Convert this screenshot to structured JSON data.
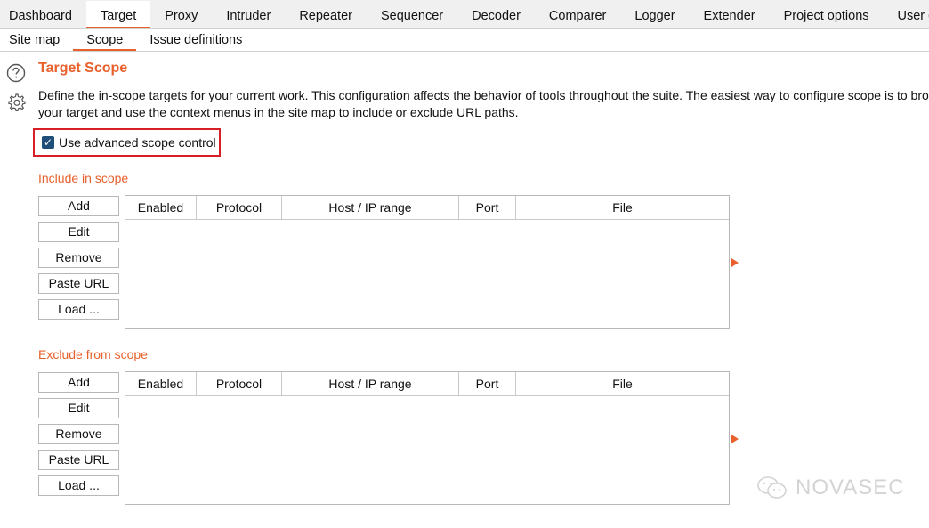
{
  "tabs": [
    "Dashboard",
    "Target",
    "Proxy",
    "Intruder",
    "Repeater",
    "Sequencer",
    "Decoder",
    "Comparer",
    "Logger",
    "Extender",
    "Project options",
    "User options"
  ],
  "subtabs": [
    "Site map",
    "Scope",
    "Issue definitions"
  ],
  "page": {
    "title": "Target Scope",
    "description": "Define the in-scope targets for your current work. This configuration affects the behavior of tools throughout the suite. The easiest way to configure scope is to browse to your target and use the context menus in the site map to include or exclude URL paths.",
    "advanced_scope_label": "Use advanced scope control",
    "advanced_scope_checked": true
  },
  "include": {
    "label": "Include in scope",
    "buttons": [
      "Add",
      "Edit",
      "Remove",
      "Paste URL",
      "Load ..."
    ],
    "columns": [
      "Enabled",
      "Protocol",
      "Host / IP range",
      "Port",
      "File"
    ]
  },
  "exclude": {
    "label": "Exclude from scope",
    "buttons": [
      "Add",
      "Edit",
      "Remove",
      "Paste URL",
      "Load ..."
    ],
    "columns": [
      "Enabled",
      "Protocol",
      "Host / IP range",
      "Port",
      "File"
    ]
  },
  "watermark": "NOVASEC",
  "colors": {
    "accent": "#e8602c",
    "highlight_border": "#d61f26",
    "checkbox": "#1f4e79"
  }
}
